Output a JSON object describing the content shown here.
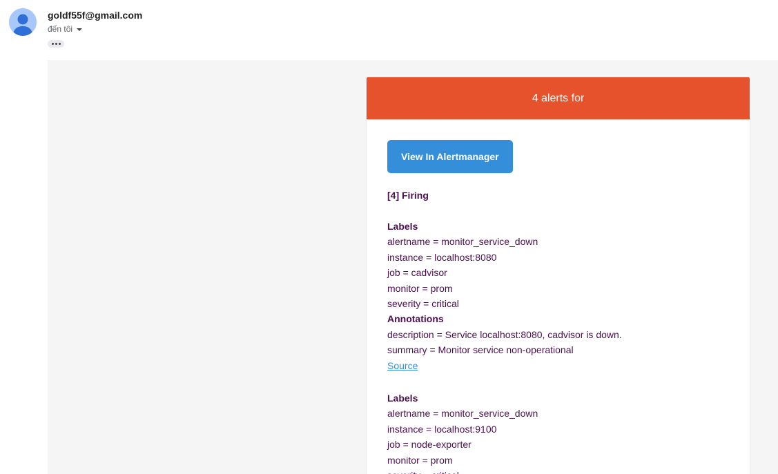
{
  "sender": {
    "email": "goldf55f@gmail.com",
    "recipient_label": "đến tôi"
  },
  "alert": {
    "header": "4 alerts for",
    "button_label": "View In Alertmanager",
    "firing_title": "[4] Firing",
    "labels_title": "Labels",
    "annotations_title": "Annotations",
    "source_label": "Source",
    "groups": [
      {
        "labels": [
          "alertname = monitor_service_down",
          "instance = localhost:8080",
          "job = cadvisor",
          "monitor = prom",
          "severity = critical"
        ],
        "annotations": [
          "description = Service localhost:8080, cadvisor is down.",
          "summary = Monitor service non-operational"
        ]
      },
      {
        "labels": [
          "alertname = monitor_service_down",
          "instance = localhost:9100",
          "job = node-exporter",
          "monitor = prom",
          "severity = critical"
        ]
      }
    ]
  },
  "colors": {
    "header": "#e6522c",
    "button": "#348eda",
    "text": "#4b0f4f",
    "link": "#348eda",
    "background": "#f5f5f5"
  },
  "icons": {
    "avatar": "default-avatar-icon",
    "more": "more-horizontal-icon",
    "caret": "caret-down-icon"
  }
}
